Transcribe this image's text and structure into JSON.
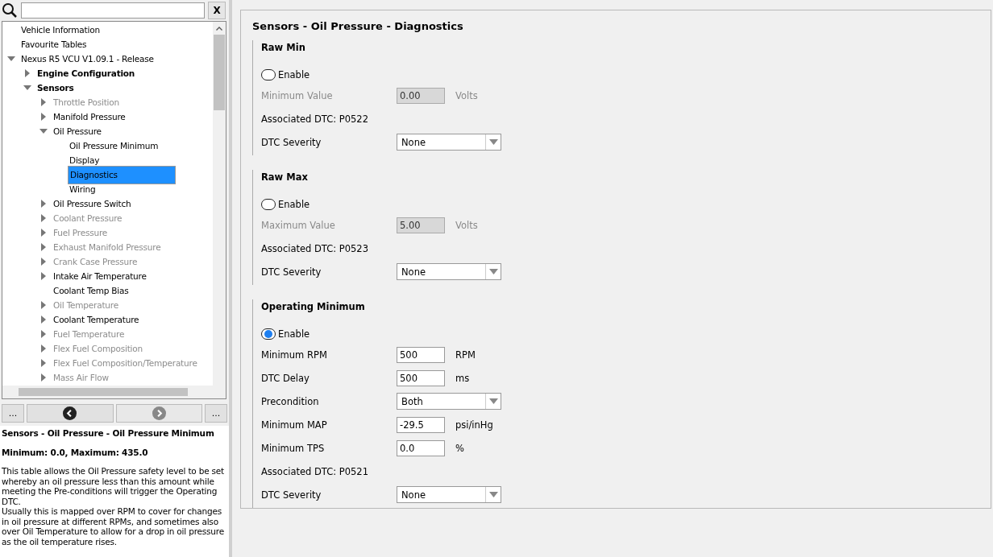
{
  "search": {
    "clear_label": "X"
  },
  "tree": [
    {
      "label": "Vehicle Information",
      "disabled": false,
      "selected": false
    },
    {
      "label": "Favourite Tables",
      "disabled": false,
      "selected": false
    },
    {
      "label": "Nexus R5 VCU V1.09.1 - Release",
      "expanded": true,
      "disabled": false,
      "selected": false,
      "children": [
        {
          "label": "Engine Configuration",
          "expanded": false,
          "disabled": false,
          "selected": false
        },
        {
          "label": "Sensors",
          "expanded": true,
          "disabled": false,
          "selected": false,
          "children": [
            {
              "label": "Throttle Position",
              "expanded": false,
              "disabled": true,
              "selected": false
            },
            {
              "label": "Manifold Pressure",
              "expanded": false,
              "disabled": false,
              "selected": false
            },
            {
              "label": "Oil Pressure",
              "expanded": true,
              "disabled": false,
              "selected": false,
              "children": [
                {
                  "label": "Oil Pressure Minimum",
                  "disabled": false,
                  "selected": false
                },
                {
                  "label": "Display",
                  "disabled": false,
                  "selected": false
                },
                {
                  "label": "Diagnostics",
                  "disabled": false,
                  "selected": true
                },
                {
                  "label": "Wiring",
                  "disabled": false,
                  "selected": false
                }
              ]
            },
            {
              "label": "Oil Pressure Switch",
              "expanded": false,
              "disabled": false,
              "selected": false
            },
            {
              "label": "Coolant Pressure",
              "expanded": false,
              "disabled": true,
              "selected": false
            },
            {
              "label": "Fuel Pressure",
              "expanded": false,
              "disabled": true,
              "selected": false
            },
            {
              "label": "Exhaust Manifold Pressure",
              "expanded": false,
              "disabled": true,
              "selected": false
            },
            {
              "label": "Crank Case Pressure",
              "expanded": false,
              "disabled": true,
              "selected": false
            },
            {
              "label": "Intake Air Temperature",
              "expanded": false,
              "disabled": false,
              "selected": false
            },
            {
              "label": "Coolant Temp Bias",
              "disabled": false,
              "selected": false
            },
            {
              "label": "Oil Temperature",
              "expanded": false,
              "disabled": true,
              "selected": false
            },
            {
              "label": "Coolant Temperature",
              "expanded": false,
              "disabled": false,
              "selected": false
            },
            {
              "label": "Fuel Temperature",
              "expanded": false,
              "disabled": true,
              "selected": false
            },
            {
              "label": "Flex Fuel Composition",
              "expanded": false,
              "disabled": true,
              "selected": false
            },
            {
              "label": "Flex Fuel Composition/Temperature",
              "expanded": false,
              "disabled": true,
              "selected": false
            },
            {
              "label": "Mass Air Flow",
              "expanded": false,
              "disabled": true,
              "selected": false
            }
          ]
        }
      ]
    }
  ],
  "nav_buttons": [
    {
      "kind": "more",
      "label": "..."
    },
    {
      "kind": "back",
      "disabled": false
    },
    {
      "kind": "forward",
      "disabled": true
    },
    {
      "kind": "more",
      "label": "..."
    }
  ],
  "description": {
    "title": "Sensors - Oil Pressure - Oil Pressure Minimum",
    "range": "Minimum: 0.0, Maximum: 435.0",
    "paragraphs": [
      "This table allows the Oil Pressure safety level to be set whereby an oil pressure less than this amount while meeting the Pre-conditions will trigger the Operating DTC.",
      "Usually this is mapped over RPM to cover for changes in oil pressure at different RPMs, and sometimes also over Oil Temperature to allow for a drop in oil pressure as the oil temperature rises."
    ]
  },
  "page": {
    "title": "Sensors - Oil Pressure - Diagnostics",
    "sections": [
      {
        "title": "Raw Min",
        "rows": [
          {
            "kind": "radio",
            "label": "Enable",
            "selected": false
          },
          {
            "kind": "input",
            "label": "Minimum Value",
            "value": "0.00",
            "unit": "Volts",
            "disabled": true
          },
          {
            "kind": "text",
            "label": "Associated DTC: P0522"
          },
          {
            "kind": "select",
            "label": "DTC Severity",
            "value": "None"
          }
        ]
      },
      {
        "title": "Raw Max",
        "rows": [
          {
            "kind": "radio",
            "label": "Enable",
            "selected": false
          },
          {
            "kind": "input",
            "label": "Maximum Value",
            "value": "5.00",
            "unit": "Volts",
            "disabled": true
          },
          {
            "kind": "text",
            "label": "Associated DTC: P0523"
          },
          {
            "kind": "select",
            "label": "DTC Severity",
            "value": "None"
          }
        ]
      },
      {
        "title": "Operating Minimum",
        "rows": [
          {
            "kind": "radio",
            "label": "Enable",
            "selected": true
          },
          {
            "kind": "input",
            "label": "Minimum RPM",
            "value": "500",
            "unit": "RPM",
            "disabled": false
          },
          {
            "kind": "input",
            "label": "DTC Delay",
            "value": "500",
            "unit": "ms",
            "disabled": false
          },
          {
            "kind": "select",
            "label": "Precondition",
            "value": "Both"
          },
          {
            "kind": "input",
            "label": "Minimum MAP",
            "value": "-29.5",
            "unit": "psi/inHg",
            "disabled": false
          },
          {
            "kind": "input",
            "label": "Minimum TPS",
            "value": "0.0",
            "unit": "%",
            "disabled": false
          },
          {
            "kind": "text",
            "label": "Associated DTC: P0521"
          },
          {
            "kind": "select",
            "label": "DTC Severity",
            "value": "None"
          }
        ]
      }
    ]
  }
}
